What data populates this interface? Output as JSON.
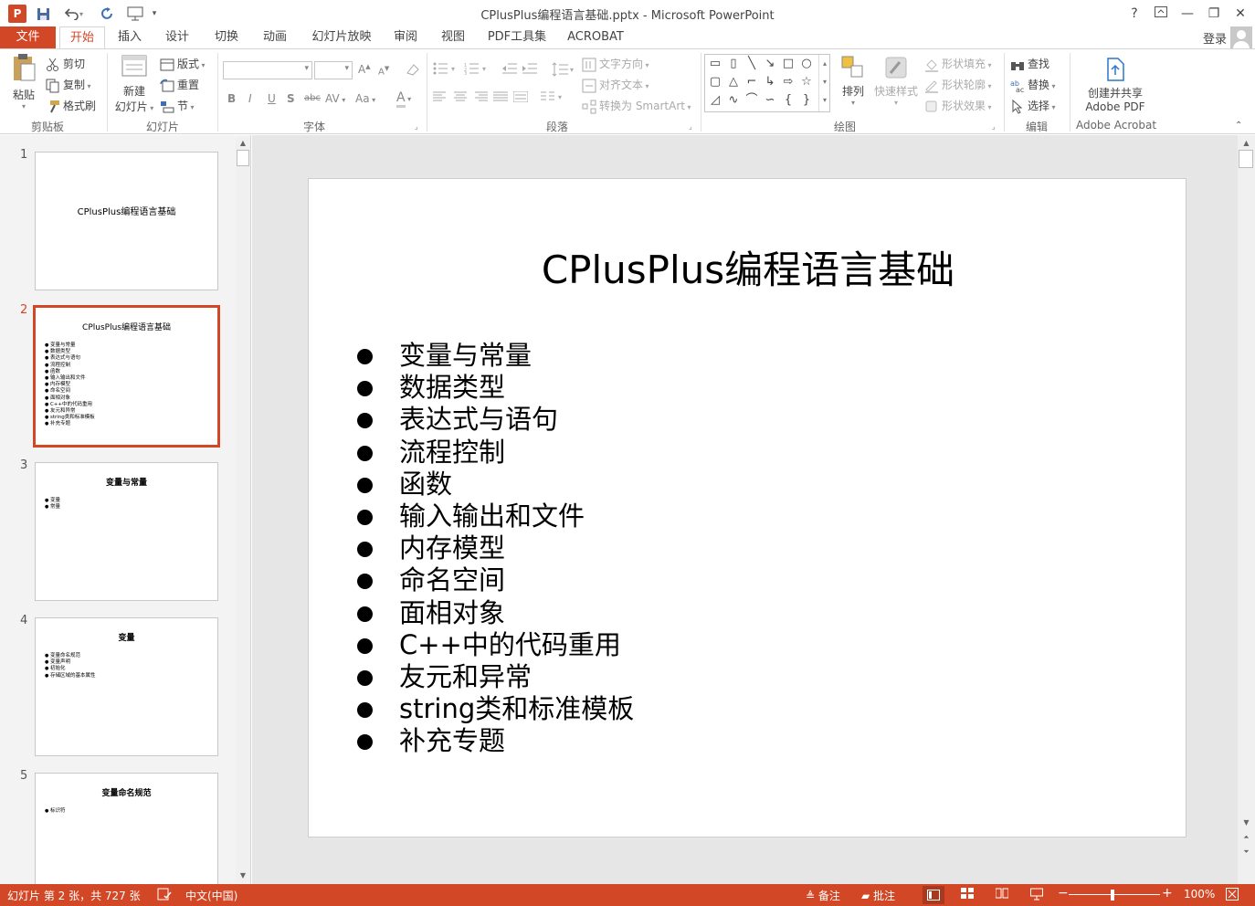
{
  "window": {
    "title": "CPlusPlus编程语言基础.pptx - Microsoft PowerPoint",
    "help": "?",
    "minimize": "—",
    "restore": "❐",
    "close": "✕"
  },
  "qat": {
    "app_icon": "P",
    "save_icon": "save-icon",
    "undo_icon": "undo-icon",
    "redo_icon": "redo-icon",
    "presenter_icon": "presenter-icon"
  },
  "tabs": {
    "file": "文件",
    "items": [
      "开始",
      "插入",
      "设计",
      "切换",
      "动画",
      "幻灯片放映",
      "审阅",
      "视图",
      "PDF工具集",
      "ACROBAT"
    ],
    "active": "开始",
    "login": "登录"
  },
  "ribbon": {
    "clipboard": {
      "paste": "粘贴",
      "cut": "剪切",
      "copy": "复制",
      "format_painter": "格式刷",
      "label": "剪贴板"
    },
    "slides": {
      "new_slide_line1": "新建",
      "new_slide_line2": "幻灯片",
      "layout": "版式",
      "reset": "重置",
      "section": "节",
      "label": "幻灯片"
    },
    "font": {
      "label": "字体",
      "bold": "B",
      "italic": "I",
      "underline": "U",
      "shadow": "S",
      "strike": "abc",
      "spacing": "AV",
      "case": "Aa",
      "color": "A"
    },
    "paragraph": {
      "text_direction": "文字方向",
      "align_text": "对齐文本",
      "smartart": "转换为 SmartArt",
      "label": "段落"
    },
    "drawing": {
      "arrange": "排列",
      "quick_styles": "快速样式",
      "shape_fill": "形状填充",
      "shape_outline": "形状轮廓",
      "shape_effects": "形状效果",
      "label": "绘图"
    },
    "editing": {
      "find": "查找",
      "replace": "替换",
      "select": "选择",
      "label": "编辑"
    },
    "acrobat": {
      "create_line1": "创建并共享",
      "create_line2": "Adobe PDF",
      "label": "Adobe Acrobat"
    }
  },
  "thumbnails": [
    {
      "number": "1",
      "title": "CPlusPlus编程语言基础",
      "bullets": []
    },
    {
      "number": "2",
      "title": "CPlusPlus编程语言基础",
      "bullets": [
        "变量与常量",
        "数据类型",
        "表达式与语句",
        "流程控制",
        "函数",
        "输入输出和文件",
        "内存模型",
        "命名空间",
        "面相对象",
        "C++中的代码重用",
        "友元和异常",
        "string类和标准模板",
        "补充专题"
      ]
    },
    {
      "number": "3",
      "title": "变量与常量",
      "bullets": [
        "变量",
        "常量"
      ]
    },
    {
      "number": "4",
      "title": "变量",
      "bullets": [
        "变量命名规范",
        "变量声明",
        "初始化",
        "存储区域的基本属性"
      ]
    },
    {
      "number": "5",
      "title": "变量命名规范",
      "bullets": [
        "标识符"
      ]
    }
  ],
  "slide": {
    "title": "CPlusPlus编程语言基础",
    "bullets": [
      "变量与常量",
      "数据类型",
      "表达式与语句",
      "流程控制",
      "函数",
      "输入输出和文件",
      "内存模型",
      "命名空间",
      "面相对象",
      "C++中的代码重用",
      "友元和异常",
      "string类和标准模板",
      "补充专题"
    ]
  },
  "status": {
    "slide_info": "幻灯片 第 2 张，共 727 张",
    "language": "中文(中国)",
    "notes": "备注",
    "comments": "批注",
    "zoom": "100%"
  },
  "colors": {
    "accent": "#d24726",
    "workspace": "#e6e6e6",
    "pane": "#f3f3f3"
  }
}
